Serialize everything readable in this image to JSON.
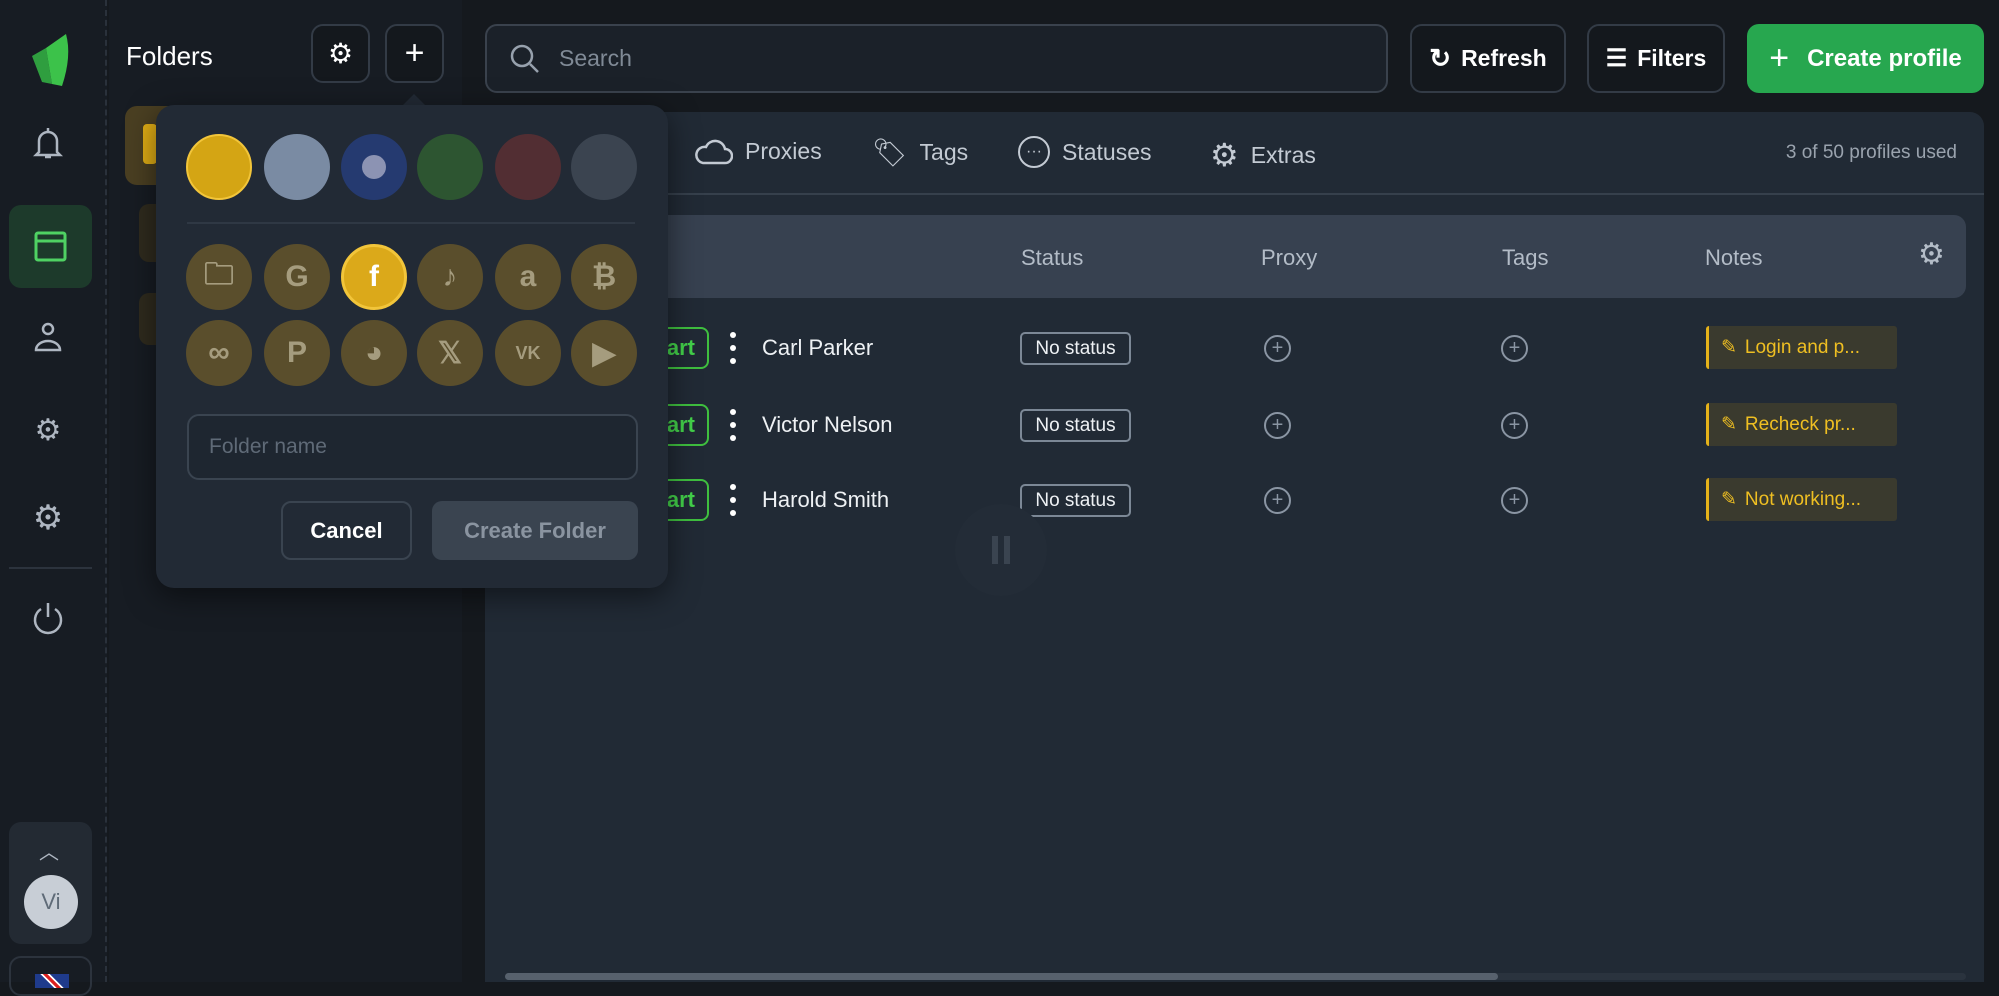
{
  "rail": {
    "items": [
      "notifications",
      "profiles",
      "accounts",
      "automation",
      "settings",
      "power"
    ],
    "active": "profiles",
    "avatar_initials": "Vi"
  },
  "folders": {
    "title": "Folders"
  },
  "popup": {
    "colors": [
      "#d4a514",
      "#7a8ba3",
      "#253a70",
      "#2d5531",
      "#522e33",
      "#3b4450"
    ],
    "selected_color": "#d4a514",
    "icons": [
      "folder",
      "google",
      "facebook",
      "tiktok",
      "amazon",
      "bitcoin",
      "meta",
      "paypal",
      "discord",
      "x",
      "vk",
      "youtube"
    ],
    "selected_icon": "facebook",
    "input_placeholder": "Folder name",
    "cancel": "Cancel",
    "create": "Create Folder"
  },
  "toolbar": {
    "search_placeholder": "Search",
    "refresh": "Refresh",
    "filters": "Filters",
    "create_profile": "Create profile"
  },
  "tabs": [
    "Proxies",
    "Tags",
    "Statuses",
    "Extras"
  ],
  "usage": "3 of 50 profiles used",
  "table": {
    "headers": {
      "status": "Status",
      "proxy": "Proxy",
      "tags": "Tags",
      "notes": "Notes"
    },
    "rows": [
      {
        "start": "art",
        "name": "Carl Parker",
        "status": "No status",
        "note": "Login and p..."
      },
      {
        "start": "art",
        "name": "Victor Nelson",
        "status": "No status",
        "note": "Recheck pr..."
      },
      {
        "start": "art",
        "name": "Harold Smith",
        "status": "No status",
        "note": "Not working..."
      }
    ]
  },
  "accent": "#27a74f"
}
